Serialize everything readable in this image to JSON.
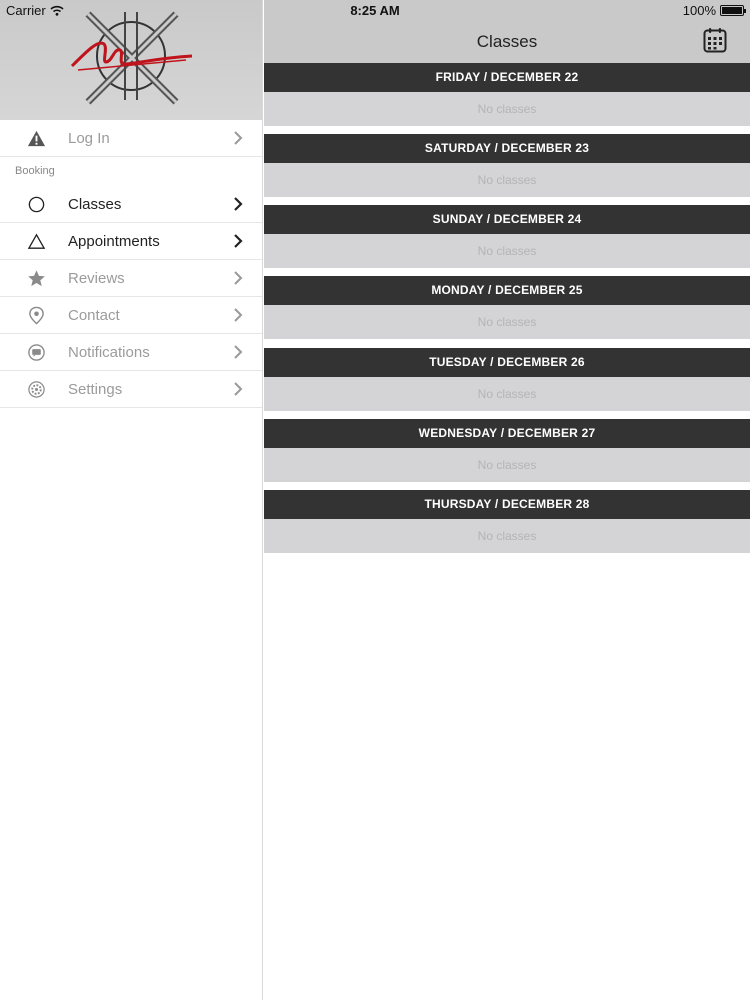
{
  "status_bar": {
    "carrier": "Carrier",
    "time": "8:25 AM",
    "battery": "100%"
  },
  "sidebar": {
    "logo_name": "maximum-logo",
    "section_label": "Booking",
    "items": [
      {
        "label": "Log In",
        "icon": "warning-icon"
      },
      {
        "label": "Classes",
        "icon": "circle-icon"
      },
      {
        "label": "Appointments",
        "icon": "triangle-icon"
      },
      {
        "label": "Reviews",
        "icon": "star-icon"
      },
      {
        "label": "Contact",
        "icon": "location-pin-icon"
      },
      {
        "label": "Notifications",
        "icon": "chat-bubble-icon"
      },
      {
        "label": "Settings",
        "icon": "gear-icon"
      }
    ]
  },
  "main": {
    "title": "Classes",
    "calendar_icon": "calendar-icon",
    "days": [
      {
        "header": "FRIDAY / DECEMBER 22",
        "body": "No classes"
      },
      {
        "header": "SATURDAY / DECEMBER 23",
        "body": "No classes"
      },
      {
        "header": "SUNDAY / DECEMBER 24",
        "body": "No classes"
      },
      {
        "header": "MONDAY / DECEMBER 25",
        "body": "No classes"
      },
      {
        "header": "TUESDAY / DECEMBER 26",
        "body": "No classes"
      },
      {
        "header": "WEDNESDAY / DECEMBER 27",
        "body": "No classes"
      },
      {
        "header": "THURSDAY / DECEMBER 28",
        "body": "No classes"
      }
    ]
  },
  "colors": {
    "day_header_bg": "#333333",
    "day_body_bg": "#d4d4d6",
    "nav_bg": "#c9c9c9",
    "logo_accent": "#c0141c"
  }
}
